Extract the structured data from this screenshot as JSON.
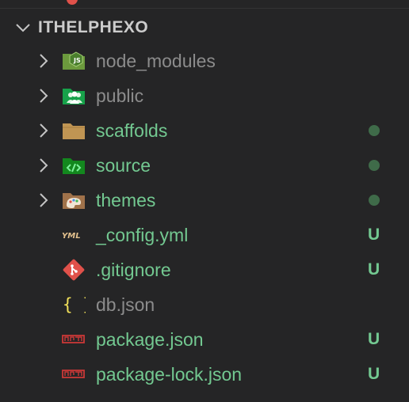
{
  "explorer": {
    "section_title": "ITHELPHEXO",
    "colors": {
      "background": "#252526",
      "ignored_text": "#8c8c8c",
      "untracked_text": "#73c991",
      "dot": "#3f6b49",
      "badge": "#73c991"
    },
    "items": [
      {
        "label": "node_modules",
        "kind": "folder",
        "icon": "nodejs-folder-icon",
        "status": "ignored",
        "decoration": ""
      },
      {
        "label": "public",
        "kind": "folder",
        "icon": "public-folder-icon",
        "status": "ignored",
        "decoration": ""
      },
      {
        "label": "scaffolds",
        "kind": "folder",
        "icon": "folder-icon",
        "status": "untracked",
        "decoration": "dot"
      },
      {
        "label": "source",
        "kind": "folder",
        "icon": "source-folder-icon",
        "status": "untracked",
        "decoration": "dot"
      },
      {
        "label": "themes",
        "kind": "folder",
        "icon": "themes-folder-icon",
        "status": "untracked",
        "decoration": "dot"
      },
      {
        "label": "_config.yml",
        "kind": "file",
        "icon": "yaml-icon",
        "status": "untracked",
        "decoration": "U"
      },
      {
        "label": ".gitignore",
        "kind": "file",
        "icon": "git-icon",
        "status": "untracked",
        "decoration": "U"
      },
      {
        "label": "db.json",
        "kind": "file",
        "icon": "json-braces-icon",
        "status": "ignored",
        "decoration": ""
      },
      {
        "label": "package.json",
        "kind": "file",
        "icon": "npm-icon",
        "status": "untracked",
        "decoration": "U"
      },
      {
        "label": "package-lock.json",
        "kind": "file",
        "icon": "npm-icon",
        "status": "untracked",
        "decoration": "U"
      }
    ]
  }
}
